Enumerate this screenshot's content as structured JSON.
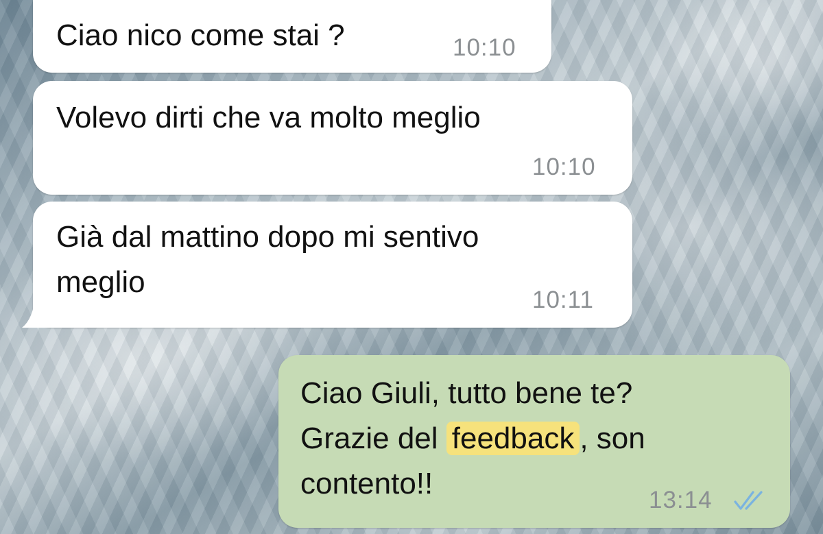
{
  "messages": [
    {
      "direction": "incoming",
      "text": "Ciao nico come stai ?",
      "time": "10:10"
    },
    {
      "direction": "incoming",
      "text": "Volevo dirti che va molto meglio",
      "time": "10:10"
    },
    {
      "direction": "incoming",
      "lines": [
        "Già dal mattino dopo mi sentivo",
        "meglio"
      ],
      "time": "10:11"
    },
    {
      "direction": "outgoing",
      "line1": "Ciao Giuli, tutto bene te?",
      "line2_before": "Grazie del ",
      "line2_highlight": "feedback",
      "line2_after": ", son",
      "line3": "contento!!",
      "time": "13:14",
      "status_icon": "double-check-read-icon"
    }
  ],
  "colors": {
    "incoming_bubble": "#ffffff",
    "outgoing_bubble": "#c6dbb5",
    "highlight": "#f6e27c",
    "timestamp": "#8b8f92",
    "read_ticks": "#7ab3e0"
  }
}
